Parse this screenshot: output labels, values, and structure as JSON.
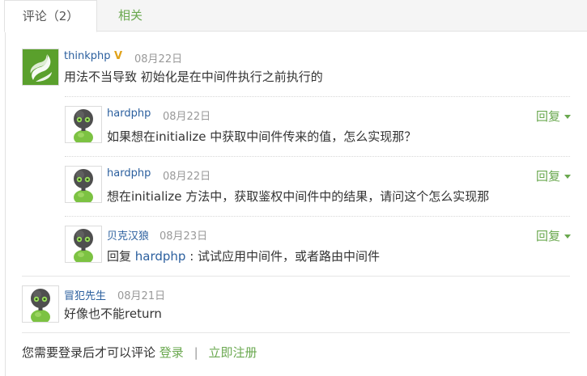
{
  "tabs": [
    {
      "label": "评论（2）"
    },
    {
      "label": "相关"
    }
  ],
  "comments": [
    {
      "user": "thinkphp",
      "badge": "V",
      "date": "08月22日",
      "text": "用法不当导致 初始化是在中间件执行之前执行的",
      "replies": [
        {
          "user": "hardphp",
          "date": "08月22日",
          "text": "如果想在initialize 中获取中间件传来的值，怎么实现那？",
          "reply_label": "回复"
        },
        {
          "user": "hardphp",
          "date": "08月22日",
          "text": "想在initialize 方法中，获取鉴权中间件中的结果，请问这个怎么实现那",
          "reply_label": "回复"
        },
        {
          "user": "贝克汉狼",
          "date": "08月23日",
          "text_prefix": "回复 ",
          "mention": "hardphp",
          "text_suffix": " : 试试应用中间件，或者路由中间件",
          "reply_label": "回复"
        }
      ]
    },
    {
      "user": "冒犯先生",
      "date": "08月21日",
      "text": "好像也不能return"
    }
  ],
  "footer": {
    "prompt": "您需要登录后才可以评论",
    "login": "登录",
    "separator": "|",
    "register": "立即注册"
  },
  "icons": {
    "thinkphp_avatar": "thinkphp-logo-icon",
    "default_avatar": "green-robot-avatar-icon",
    "reply_caret": "caret-down-icon"
  },
  "colors": {
    "link_green": "#6aa84f",
    "username_blue": "#2b5f9e",
    "date_gray": "#999999",
    "badge_gold": "#e0a21a"
  }
}
